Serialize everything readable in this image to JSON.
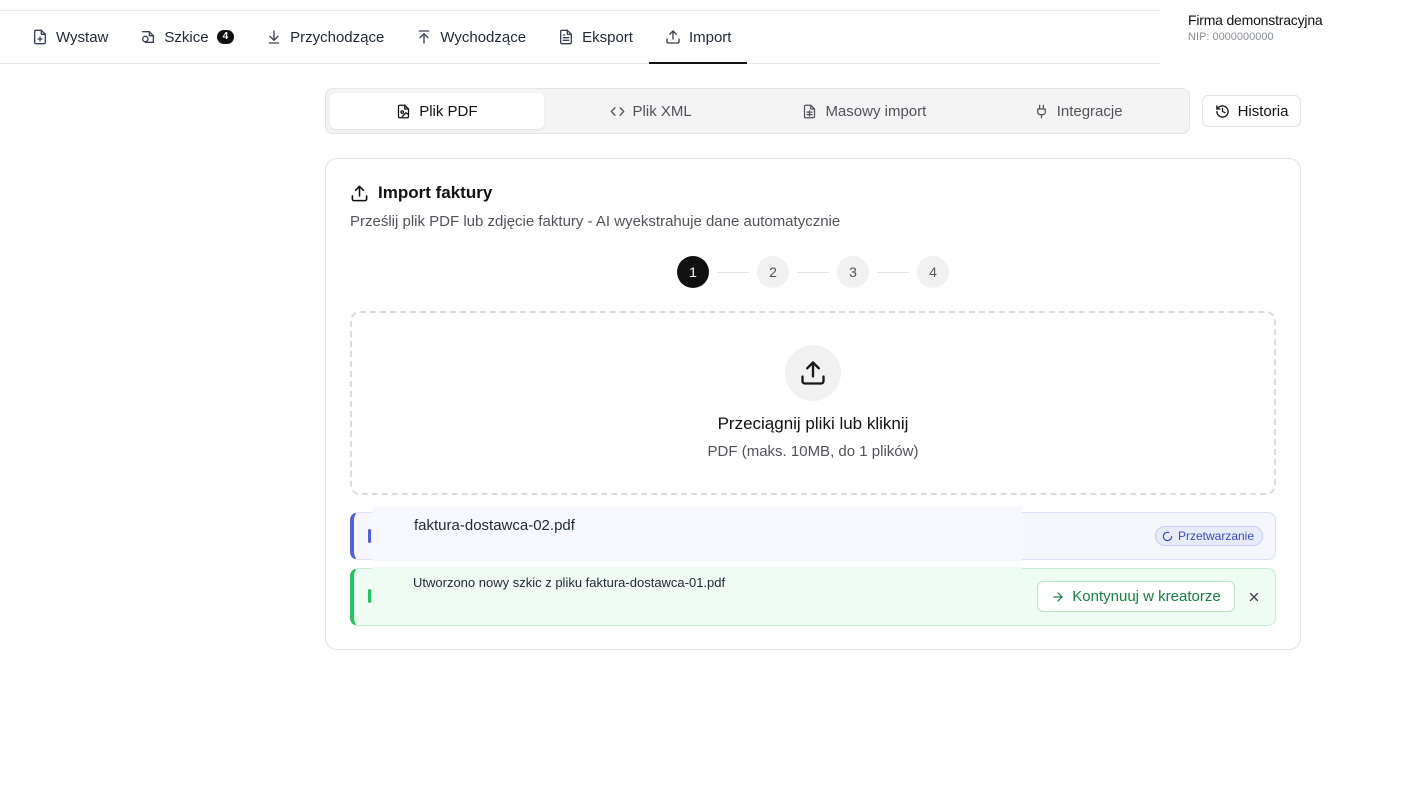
{
  "nav": {
    "items": [
      {
        "label": "Wystaw",
        "icon": "file-plus-icon"
      },
      {
        "label": "Szkice",
        "icon": "drafts-icon",
        "count": "4"
      },
      {
        "label": "Przychodzące",
        "icon": "download-icon"
      },
      {
        "label": "Wychodzące",
        "icon": "upload-icon"
      },
      {
        "label": "Eksport",
        "icon": "file-text-icon"
      },
      {
        "label": "Import",
        "icon": "upload-tray-icon",
        "active": true
      }
    ]
  },
  "company": {
    "name": "Firma demonstracyjna",
    "nip": "NIP: 0000000000"
  },
  "tabs": [
    {
      "label": "Plik PDF",
      "icon": "file-pdf-icon",
      "active": true
    },
    {
      "label": "Plik XML",
      "icon": "code-icon"
    },
    {
      "label": "Masowy import",
      "icon": "file-spreadsheet-icon"
    },
    {
      "label": "Integracje",
      "icon": "plug-icon"
    }
  ],
  "history": {
    "label": "Historia",
    "icon": "history-icon"
  },
  "card": {
    "title": "Import faktury",
    "subtitle": "Prześlij plik PDF lub zdjęcie faktury - AI wyekstrahuje dane automatycznie"
  },
  "steps": [
    "1",
    "2",
    "3",
    "4"
  ],
  "current_step": 1,
  "dropzone": {
    "title": "Przeciągnij pliki lub kliknij",
    "hint": "PDF (maks. 10MB, do 1 plików)"
  },
  "files": {
    "processing": {
      "name": "faktura-dostawca-02.pdf",
      "status": "Przetwarzanie"
    },
    "done": {
      "message": "Utworzono nowy szkic z pliku faktura-dostawca-01.pdf",
      "action": "Kontynuuj w kreatorze"
    }
  },
  "colors": {
    "accent": "#111111",
    "processing": "#4c62e3",
    "success": "#22c55e",
    "success_text": "#15803d"
  }
}
